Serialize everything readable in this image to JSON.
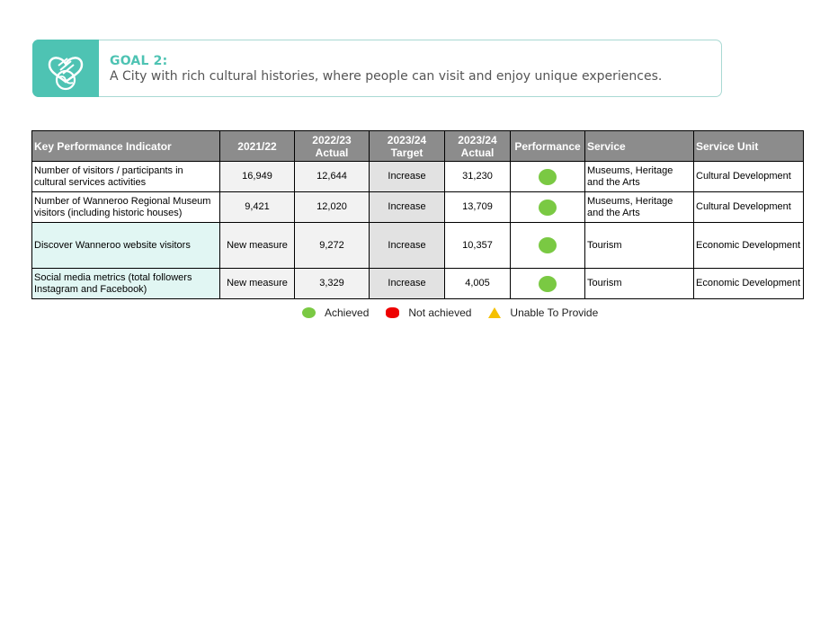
{
  "goal": {
    "label": "GOAL 2:",
    "text": "A City with rich cultural histories, where people can visit and enjoy unique experiences.",
    "icon": "heart-globe-icon",
    "accent_color": "#4ec3b3"
  },
  "table": {
    "headers": {
      "kpi": "Key Performance Indicator",
      "y2122": "2021/22",
      "y2223_top": "2022/23",
      "y2223_bottom": "Actual",
      "y2324t_top": "2023/24",
      "y2324t_bottom": "Target",
      "y2324a_top": "2023/24",
      "y2324a_bottom": "Actual",
      "performance": "Performance",
      "service": "Service",
      "unit": "Service Unit"
    },
    "rows": [
      {
        "kpi": "Number of visitors / participants in cultural services activities",
        "y2122": "16,949",
        "y2223": "12,644",
        "target": "Increase",
        "actual": "31,230",
        "performance": "Achieved",
        "service": "Museums, Heritage and the Arts",
        "unit": "Cultural Development"
      },
      {
        "kpi": "Number of Wanneroo Regional Museum visitors (including historic houses)",
        "y2122": "9,421",
        "y2223": "12,020",
        "target": "Increase",
        "actual": "13,709",
        "performance": "Achieved",
        "service": "Museums, Heritage and the Arts",
        "unit": "Cultural Development"
      },
      {
        "kpi": "Discover Wanneroo website visitors",
        "y2122": "New measure",
        "y2223": "9,272",
        "target": "Increase",
        "actual": "10,357",
        "performance": "Achieved",
        "service": "Tourism",
        "unit": "Economic Development"
      },
      {
        "kpi": "Social media metrics (total followers Instagram and Facebook)",
        "y2122": "New measure",
        "y2223": "3,329",
        "target": "Increase",
        "actual": "4,005",
        "performance": "Achieved",
        "service": "Tourism",
        "unit": "Economic Development"
      }
    ]
  },
  "legend": {
    "achieved": "Achieved",
    "not_achieved": "Not achieved",
    "unable": "Unable To Provide",
    "colors": {
      "achieved": "#7ac943",
      "not_achieved": "#ee0000",
      "unable": "#f5c000"
    }
  }
}
